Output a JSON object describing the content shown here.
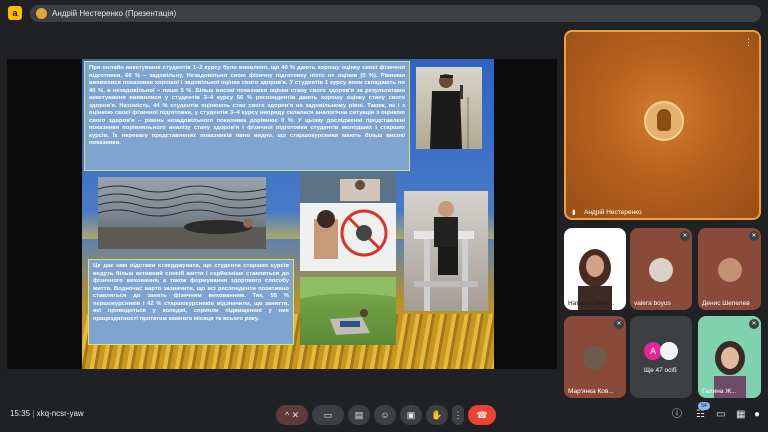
{
  "window": {
    "title": "Андрій Нестеренко (Презентація)",
    "logo_letter": "a"
  },
  "slide": {
    "paragraph1": "При онлайн анкетуванні студентів 1–2 курсу було виявлено, що 40 % дають хорошу оцінку своєї фізичної підготовки, 60 % – задовільну. Незадовільно свою фізичну підготовку ніхто не оцінив (0 %). Рівними виявилися показники хорошої і задовільної оцінки свого здоров'я. У студентів 1 курсу вони складають по 40 %, а незадовільної – лише 5 %. Більш високі показники оцінки стану свого здоров'я за результатами анкетування виявилися у студентів 3–4 курсу 56 % респондентів дають хорошу оцінку стану свого здоров'я. Натомість, 44 % студентів оцінюють стан свого здоров'я на задовільному рівні. Також, як і з оцінкою своєї фізичної підготовки, у студентів 3–4 курсу напряду склалася аналогічна ситуація з оцінкою свого здоров'я – рівень незадовільного показника дорівнює 0 %. У цьому дослідженні представлені показники порівняльного аналізу стану здоров'я і фізичної підготовки студентів молодших і старших курсів. Їх перевагу представлених показників явно видно, що старшокурсники мають більш високі показники.",
    "paragraph2": "Це дає нам підстави стверджувати, що студенти старших курсів ведуть більш активний спосіб життя і серйозніше ставляться до фізичного виховання, а також формування здорового способу життя. Водночас варто зазначити, що всі респонденти позитивно ставляться до занять фізичним вихованням. Так, 55 % першокурсників і 42 % старшокурсників відзначили, що заняття, які проводяться у коледжі, сприяли підвищенню у них працездатності протягом кожного місяця та всього року."
  },
  "participants": {
    "presenter": "Андрій Нестеренко",
    "tiles": [
      {
        "name": "Наталія Вінок..."
      },
      {
        "name": "valera boyus"
      },
      {
        "name": "Денис Шепелев"
      },
      {
        "name": "Мар'янка Ков..."
      },
      {
        "name": "Ще 47 осіб",
        "avatar_letter": "A"
      },
      {
        "name": "Галина Ж..."
      }
    ]
  },
  "bottom": {
    "time": "15:35",
    "separator": "|",
    "meeting_code": "xkq-ncsr-yaw",
    "participant_count": "54"
  },
  "colors": {
    "accent": "#e8a33d",
    "hangup": "#ea4335",
    "background": "#202124"
  }
}
